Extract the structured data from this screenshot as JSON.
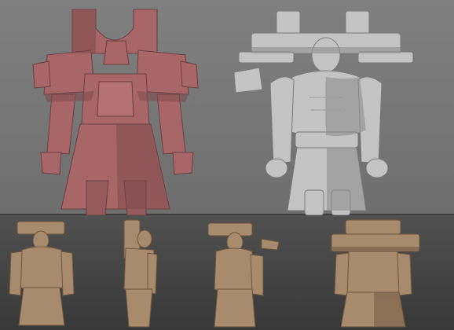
{
  "image": {
    "kind": "3d-character-model-turnaround-sheet",
    "views": [
      {
        "name": "low-poly-blockout",
        "material": "flat-shaded",
        "color": "#a86668"
      },
      {
        "name": "high-poly-sculpt",
        "material": "clay-grey",
        "color": "#c8c8c8"
      },
      {
        "name": "turnaround-front",
        "material": "clay-tan",
        "color": "#a88a6c"
      },
      {
        "name": "turnaround-side",
        "material": "clay-tan",
        "color": "#a88a6c"
      },
      {
        "name": "turnaround-three-quarter",
        "material": "clay-tan",
        "color": "#a88a6c"
      },
      {
        "name": "turnaround-back",
        "material": "clay-tan",
        "color": "#a88a6c"
      }
    ],
    "colors": {
      "viewport_top": "#808080",
      "viewport_bottom": "#444444",
      "lowpoly": "#a86668",
      "lowpoly_shadow": "#7e4a4c",
      "sculpt": "#c4c4c4",
      "sculpt_shadow": "#8e8e8e",
      "clay": "#a88a6c",
      "clay_shadow": "#6e5640"
    }
  }
}
